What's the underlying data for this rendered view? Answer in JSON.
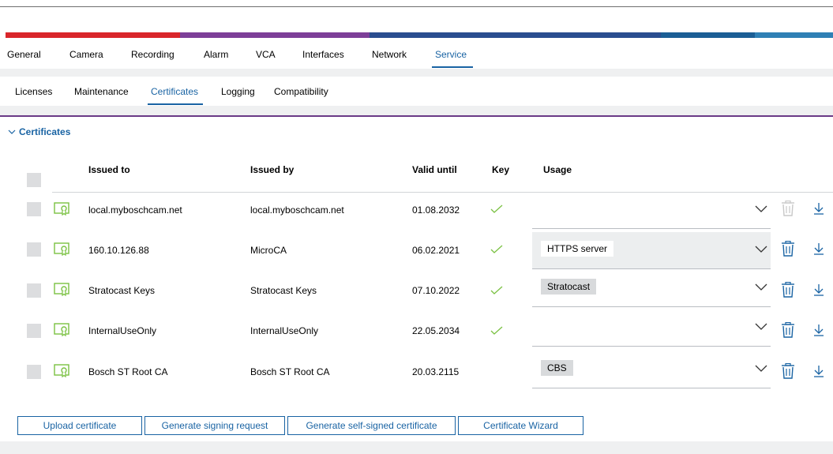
{
  "colors": {
    "stripe": [
      "#d9262b",
      "#7d3f98",
      "#2a4d8f",
      "#1b5e95",
      "#2f80b5"
    ],
    "accent": "#1963a3",
    "check": "#7ac142",
    "cert_icon": "#7ac142"
  },
  "main_tabs": [
    {
      "label": "General"
    },
    {
      "label": "Camera"
    },
    {
      "label": "Recording"
    },
    {
      "label": "Alarm"
    },
    {
      "label": "VCA"
    },
    {
      "label": "Interfaces"
    },
    {
      "label": "Network"
    },
    {
      "label": "Service"
    }
  ],
  "main_tabs_active": "Service",
  "sub_tabs": [
    {
      "label": "Licenses"
    },
    {
      "label": "Maintenance"
    },
    {
      "label": "Certificates"
    },
    {
      "label": "Logging"
    },
    {
      "label": "Compatibility"
    }
  ],
  "sub_tabs_active": "Certificates",
  "section": {
    "title": "Certificates",
    "expanded": true
  },
  "table": {
    "columns": [
      "Issued to",
      "Issued by",
      "Valid until",
      "Key",
      "Usage"
    ],
    "rows": [
      {
        "issued_to": "local.myboschcam.net",
        "issued_by": "local.myboschcam.net",
        "valid_until": "01.08.2032",
        "key": true,
        "usage": "",
        "delete_enabled": false
      },
      {
        "issued_to": "160.10.126.88",
        "issued_by": "MicroCA",
        "valid_until": "06.02.2021",
        "key": true,
        "usage": "HTTPS server",
        "delete_enabled": true
      },
      {
        "issued_to": "Stratocast Keys",
        "issued_by": "Stratocast Keys",
        "valid_until": "07.10.2022",
        "key": true,
        "usage": "Stratocast",
        "delete_enabled": true
      },
      {
        "issued_to": "InternalUseOnly",
        "issued_by": "InternalUseOnly",
        "valid_until": "22.05.2034",
        "key": true,
        "usage": "",
        "delete_enabled": true
      },
      {
        "issued_to": "Bosch ST Root CA",
        "issued_by": "Bosch ST Root CA",
        "valid_until": "20.03.2115",
        "key": false,
        "usage": "CBS",
        "delete_enabled": true
      }
    ]
  },
  "buttons": {
    "upload": "Upload certificate",
    "signing_request": "Generate signing request",
    "self_signed": "Generate self-signed certificate",
    "wizard": "Certificate Wizard"
  }
}
